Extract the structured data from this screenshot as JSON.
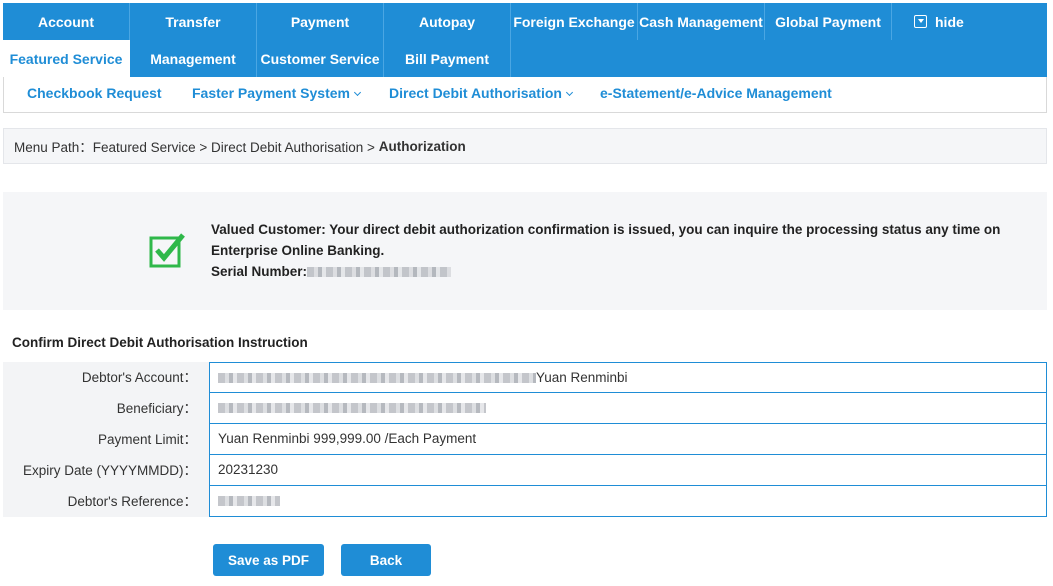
{
  "nav": {
    "row1": [
      "Account",
      "Transfer",
      "Payment",
      "Autopay",
      "Foreign Exchange",
      "Cash Management",
      "Global Payment"
    ],
    "hide_label": "hide",
    "row2": [
      "Featured Service",
      "Management",
      "Customer Service",
      "Bill Payment"
    ],
    "active": "Featured Service"
  },
  "subnav": {
    "checkbook": "Checkbook Request",
    "fps": "Faster Payment System",
    "ddauth": "Direct Debit Authorisation",
    "estatement": "e-Statement/e-Advice Management"
  },
  "breadcrumb": {
    "prefix": "Menu Path：Featured Service > Direct Debit Authorisation > ",
    "current": "Authorization"
  },
  "message": {
    "text": "Valued Customer: Your direct debit authorization confirmation is issued, you can inquire the processing status any time on Enterprise Online Banking.",
    "serial_label": "Serial Number:"
  },
  "section_title": "Confirm Direct Debit Authorisation Instruction",
  "details": {
    "debtor_account_label": "Debtor's Account：",
    "debtor_account_currency": "Yuan Renminbi",
    "beneficiary_label": "Beneficiary：",
    "payment_limit_label": "Payment Limit：",
    "payment_limit_value": "Yuan Renminbi 999,999.00 /Each Payment",
    "expiry_label": "Expiry Date (YYYYMMDD)：",
    "expiry_value": "20231230",
    "reference_label": "Debtor's Reference："
  },
  "buttons": {
    "save_pdf": "Save as PDF",
    "back": "Back"
  },
  "colors": {
    "brand_blue": "#1f8dd6",
    "success_green": "#2fb84a"
  },
  "icons": {
    "success": "check-icon",
    "hide": "collapse-icon",
    "dropdown": "chevron-down-icon"
  }
}
